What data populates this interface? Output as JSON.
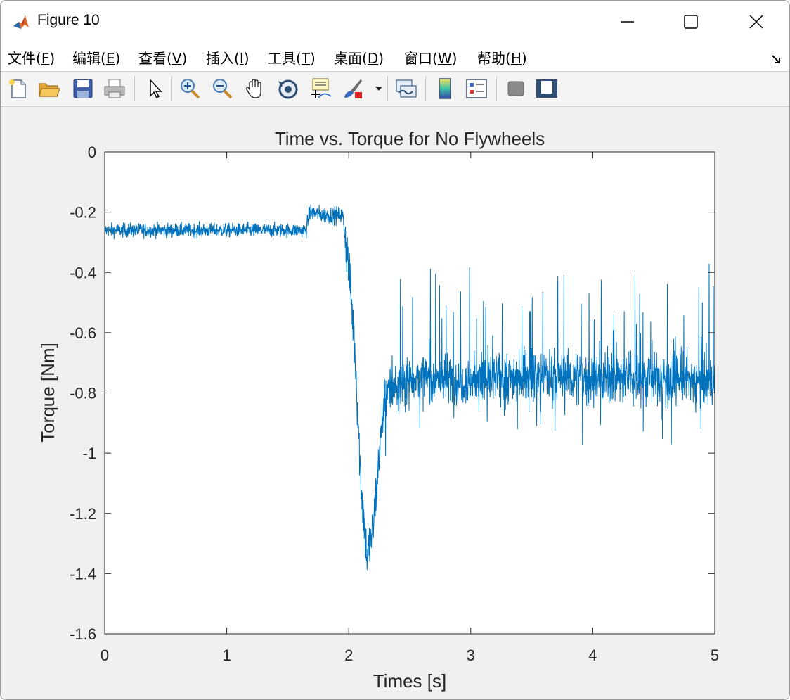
{
  "window": {
    "title": "Figure 10",
    "app_icon": "matlab-icon",
    "controls": [
      "minimize-icon",
      "maximize-icon",
      "close-icon"
    ]
  },
  "menu": [
    {
      "label": "文件(",
      "key": "F",
      "end": ")"
    },
    {
      "label": "编辑(",
      "key": "E",
      "end": ")"
    },
    {
      "label": "查看(",
      "key": "V",
      "end": ")"
    },
    {
      "label": "插入(",
      "key": "I",
      "end": ")"
    },
    {
      "label": "工具(",
      "key": "T",
      "end": ")"
    },
    {
      "label": "桌面(",
      "key": "D",
      "end": ")"
    },
    {
      "label": "窗口(",
      "key": "W",
      "end": ")"
    },
    {
      "label": "帮助(",
      "key": "H",
      "end": ")"
    }
  ],
  "toolbar": [
    "new-figure-icon",
    "open-icon",
    "save-icon",
    "print-icon",
    "pointer-icon",
    "zoom-in-icon",
    "zoom-out-icon",
    "pan-icon",
    "rotate-icon",
    "data-cursor-icon",
    "brush-icon",
    "link-plot-icon",
    "colorbar-icon",
    "legend-icon",
    "hide-plot-tools-icon",
    "show-plot-tools-icon"
  ],
  "chart_data": {
    "type": "line",
    "title": "Time vs. Torque for No Flywheels",
    "xlabel": "Times [s]",
    "ylabel": "Torque [Nm]",
    "xlim": [
      0,
      5
    ],
    "ylim": [
      -1.6,
      0
    ],
    "xticks": [
      "0",
      "1",
      "2",
      "3",
      "4",
      "5"
    ],
    "yticks": [
      "0",
      "-0.2",
      "-0.4",
      "-0.6",
      "-0.8",
      "-1",
      "-1.2",
      "-1.4",
      "-1.6"
    ],
    "grid": false,
    "line_color": "#0072BD",
    "series": [
      {
        "x": [
          0,
          0.5,
          1.0,
          1.5,
          1.65,
          1.68,
          1.8,
          1.95,
          2.0,
          2.05,
          2.1,
          2.15,
          2.2,
          2.25,
          2.3,
          2.5,
          3.0,
          3.5,
          4.0,
          4.5,
          5.0
        ],
        "y": [
          -0.26,
          -0.26,
          -0.26,
          -0.26,
          -0.26,
          -0.2,
          -0.21,
          -0.21,
          -0.38,
          -0.65,
          -1.1,
          -1.35,
          -1.25,
          -1.0,
          -0.8,
          -0.75,
          -0.76,
          -0.74,
          -0.75,
          -0.75,
          -0.76
        ]
      }
    ]
  }
}
